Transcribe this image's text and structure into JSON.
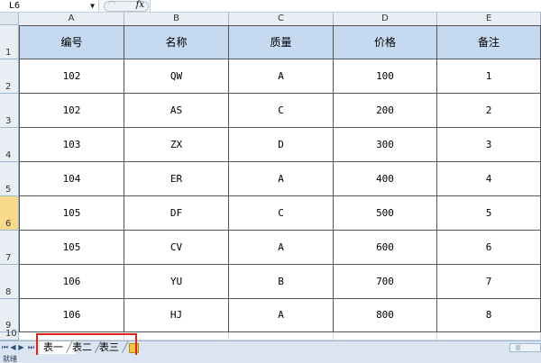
{
  "formula_bar": {
    "name_box": "L6",
    "fx_label": "fx",
    "formula": ""
  },
  "columns": [
    "A",
    "B",
    "C",
    "D",
    "E"
  ],
  "row_numbers": [
    "1",
    "2",
    "3",
    "4",
    "5",
    "6",
    "7",
    "8",
    "9",
    "10"
  ],
  "active_row": "6",
  "table": {
    "headers": [
      "编号",
      "名称",
      "质量",
      "价格",
      "备注"
    ],
    "rows": [
      [
        "102",
        "QW",
        "A",
        "100",
        "1"
      ],
      [
        "102",
        "AS",
        "C",
        "200",
        "2"
      ],
      [
        "103",
        "ZX",
        "D",
        "300",
        "3"
      ],
      [
        "104",
        "ER",
        "A",
        "400",
        "4"
      ],
      [
        "105",
        "DF",
        "C",
        "500",
        "5"
      ],
      [
        "105",
        "CV",
        "A",
        "600",
        "6"
      ],
      [
        "106",
        "YU",
        "B",
        "700",
        "7"
      ],
      [
        "106",
        "HJ",
        "A",
        "800",
        "8"
      ]
    ]
  },
  "sheet_tabs": [
    "表一",
    "表二",
    "表三"
  ],
  "status": "就绪",
  "colors": {
    "header_fill": "#c5d9f1",
    "active_row": "#f9d98b",
    "highlight_box": "#e0251b"
  }
}
